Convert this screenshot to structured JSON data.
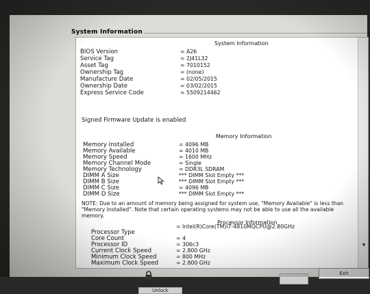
{
  "panel": {
    "title": "System Information"
  },
  "system": {
    "heading": "System Information",
    "rows": [
      {
        "label": "BIOS Version",
        "value": "= A26"
      },
      {
        "label": "Service Tag",
        "value": "= 2J41L32"
      },
      {
        "label": "Asset Tag",
        "value": "= 7010152"
      },
      {
        "label": "Ownership Tag",
        "value": "= (none)"
      },
      {
        "label": "Manufacture Date",
        "value": "= 02/05/2015"
      },
      {
        "label": "Ownership Date",
        "value": "= 03/02/2015"
      },
      {
        "label": "Express Service Code",
        "value": "= 5509214462"
      }
    ]
  },
  "firmware_text": "Signed Firmware Update is enabled",
  "memory": {
    "heading": "Memory Information",
    "rows": [
      {
        "label": "Memory Installed",
        "value": "= 4096 MB"
      },
      {
        "label": "Memory Available",
        "value": "= 4010 MB"
      },
      {
        "label": "Memory Speed",
        "value": "= 1600 MHz"
      },
      {
        "label": "Memory Channel Mode",
        "value": "= Single"
      },
      {
        "label": "Memory Technology",
        "value": "= DDR3L SDRAM"
      },
      {
        "label": "DIMM A Size",
        "value": "*** DIMM Slot Empty ***"
      },
      {
        "label": "DIMM B Size",
        "value": "*** DIMM Slot Empty ***"
      },
      {
        "label": "DIMM C Size",
        "value": "= 4096 MB"
      },
      {
        "label": "DIMM D Size",
        "value": "*** DIMM Slot Empty ***"
      }
    ]
  },
  "note": "NOTE: Due to an amount of memory being assigned for system use, \"Memory Available\" is less than \"Memory Installed\". Note that certain operating systems may not be able to use all the available memory.",
  "processor": {
    "heading": "Processor Information",
    "rows": [
      {
        "label": "Processor Type",
        "value": "= Intel(R)Core(TM)i7-4810MQCPU@2.80GHz"
      },
      {
        "label": "Core Count",
        "value": "= 4"
      },
      {
        "label": "Processor ID",
        "value": "= 306c3"
      },
      {
        "label": "Current Clock Speed",
        "value": "= 2.800 GHz"
      },
      {
        "label": "Minimum Clock Speed",
        "value": "= 800 MHz"
      },
      {
        "label": "Maximum Clock Speed",
        "value": "= 2.800 GHz"
      }
    ]
  },
  "buttons": {
    "exit": "Exit",
    "unlock": "Unlock"
  },
  "icons": {
    "lock": "lock-icon",
    "cursor": "mouse-pointer-icon",
    "scroll": "scroll-down-arrow-icon"
  }
}
